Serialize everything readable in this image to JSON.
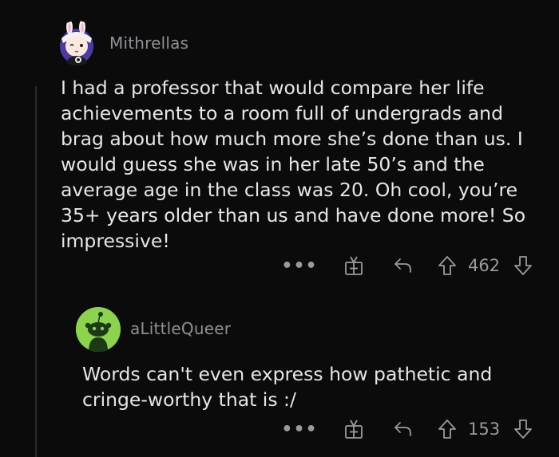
{
  "comments": [
    {
      "username": "Mithrellas",
      "text": "I had a professor that would compare her life achievements to a room full of undergrads and brag about how much more she’s done than us. I would guess she was in her late 50’s and the average age in the class was 20. Oh cool, you’re 35+ years older than us and have done more! So impressive!",
      "more_label": "•••",
      "score": "462",
      "avatar_icon": "anime-bunny-avatar-icon"
    },
    {
      "username": "aLittleQueer",
      "text": "Words can't even express how pathetic and cringe-worthy that is :/",
      "more_label": "•••",
      "score": "153",
      "avatar_icon": "snoo-avatar-icon"
    }
  ],
  "colors": {
    "background": "#0b0b0b",
    "text": "#e6e6e6",
    "muted": "#8e9196",
    "thread_line": "#2a2a2a",
    "snoo_green": "#8cd34e"
  }
}
